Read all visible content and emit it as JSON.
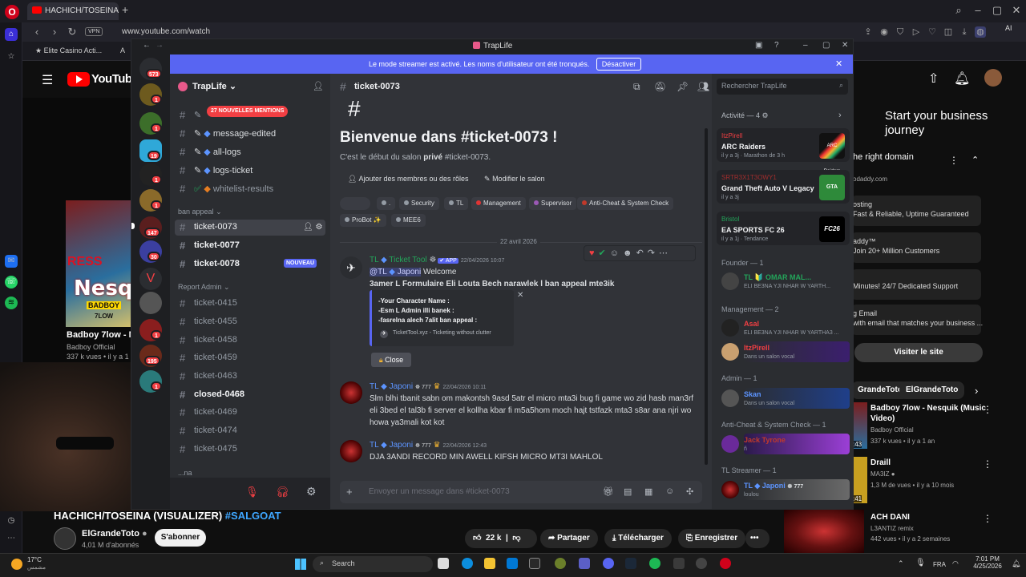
{
  "browser": {
    "tab_title": "HACHICH/TOSEINA (VISU...",
    "url": "www.youtube.com/watch",
    "vpn": "VPN",
    "ai_label": "AI",
    "bookmarks": [
      "Elite Casino Acti...",
      "A"
    ]
  },
  "youtube": {
    "logo_text": "YouTube",
    "video_title": "HACHICH/TOSEINA (VISUALIZER)",
    "video_hashtag": "#SALGOAT",
    "channel": "ElGrandeToto",
    "subs": "4,01 M d'abonnés",
    "subscribe": "S'abonner",
    "likes": "22 k",
    "share": "Partager",
    "download": "Télécharger",
    "save": "Enregistrer",
    "more": "•••",
    "side_thumb": {
      "ress": "RESS",
      "nesq": "Nesqui",
      "badboy": "BADBOY",
      "seven_low": "7LOW"
    },
    "side_video": {
      "title": "Badboy 7low - N",
      "channel": "Badboy Official",
      "stats": "337 k vues • il y a 1"
    },
    "ad": {
      "headline": "Start your business journey",
      "domain": "he right domain",
      "site": "odaddy.com",
      "lines": [
        "osting",
        "Fast & Reliable, Uptime Guaranteed",
        "addy™",
        "Join 20+ Million Customers",
        "Minutes! 24/7 Dedicated Support",
        "g Email",
        "with email that matches your business ..."
      ],
      "visit": "Visiter le site"
    },
    "chips": [
      "GrandeToto",
      "ElGrandeToto"
    ],
    "recs": [
      {
        "title": "Badboy 7low - Nesquik (Music",
        "title2": "Video)",
        "channel": "Badboy Official",
        "stats": "337 k vues • il y a 1 an",
        "dur": ":43"
      },
      {
        "title": "Draill",
        "channel": "MA3IZ",
        "stats": "1,3 M de vues • il y a 10 mois",
        "dur": ":41"
      },
      {
        "title": "ACH DANI",
        "channel": "L3ANTIZ remix",
        "stats": "442 vues • il y a 2 semaines",
        "dur": ""
      }
    ]
  },
  "taskbar": {
    "temp": "17°C",
    "weather": "مشمس",
    "search": "Search",
    "lang": "FRA",
    "time": "7:01 PM",
    "date": "4/25/2026"
  },
  "discord": {
    "app_title": "TrapLife",
    "banner": "Le mode streamer est activé. Les noms d'utilisateur ont été tronqués.",
    "banner_btn": "Désactiver",
    "guild": "TrapLife",
    "mentions_pill": "27 NOUVELLES MENTIONS",
    "server_badges": [
      "573",
      "1",
      "1",
      "19",
      "1",
      "1",
      "147",
      "30",
      "1",
      "195",
      "1"
    ],
    "channels_top": [
      "message-edited",
      "all-logs",
      "logs-ticket",
      "whitelist-results"
    ],
    "cat_ban": "ban appeal",
    "ban_channels": [
      "ticket-0073",
      "ticket-0077",
      "ticket-0078"
    ],
    "nouveau": "NOUVEAU",
    "cat_report": "Report Admin",
    "report_channels": [
      "ticket-0415",
      "ticket-0455",
      "ticket-0458",
      "ticket-0459",
      "ticket-0463",
      "closed-0468",
      "ticket-0469",
      "ticket-0474",
      "ticket-0475"
    ],
    "cat_partial": "...na",
    "chat": {
      "channel": "ticket-0073",
      "welcome_title": "Bienvenue dans #ticket-0073 !",
      "welcome_pre": "C'est le début du salon ",
      "welcome_bold": "privé",
      "welcome_post": " #ticket-0073.",
      "add_members": "Ajouter des membres ou des rôles",
      "edit_channel": "Modifier le salon",
      "roles": [
        {
          "name": ".",
          "color": "#949ba4"
        },
        {
          "name": "Security",
          "color": "#949ba4"
        },
        {
          "name": "TL",
          "color": "#949ba4"
        },
        {
          "name": "Management",
          "color": "#e03434"
        },
        {
          "name": "Supervisor",
          "color": "#9b59b6"
        },
        {
          "name": "Anti-Cheat & System Check",
          "color": "#c0392b"
        },
        {
          "name": "ProBot ✨",
          "color": "#949ba4"
        },
        {
          "name": "MEE6",
          "color": "#949ba4"
        }
      ],
      "date": "22 avril 2026",
      "msg1": {
        "tag": "TL",
        "name": "Ticket Tool",
        "app": "✔ APP",
        "time": "22/04/2026 10:07",
        "mention_tag": "@TL",
        "mention_name": "Japoni",
        "welcome_word": "Welcome",
        "line2": "3amer L Formulaire Eli Louta Bech narawlek l ban appeal mte3ik",
        "embed": [
          "-Your Character Name :",
          "-Esm L Admin illi banek :",
          "-fasrelna alech 7alit ban appeal :"
        ],
        "embed_footer": "TicketTool.xyz - Ticketing without clutter",
        "close": "Close"
      },
      "msg2": {
        "tag": "TL",
        "name": "Japoni",
        "badge": "777",
        "time": "22/04/2026 10:11",
        "text": "Slm blhi tbanit sabn om makontsh 9asd 5atr el micro mta3i bug fi game wo zid hasb man3rf eli 3bed el tal3b fi server el kollha kbar fi m5a5hom moch hajt tstfazk mta3 s8ar ana njri wo howa ya3mali kot kot"
      },
      "msg3": {
        "tag": "TL",
        "name": "Japoni",
        "badge": "777",
        "time": "22/04/2026 12:43",
        "text": "DJA 3ANDI RECORD MIN AWELL KIFSH MICRO MT3I MAHLOL"
      },
      "composer": "Envoyer un message dans #ticket-0073"
    },
    "members": {
      "search": "Rechercher TrapLife",
      "activity_head": "Activité — 4",
      "activities": [
        {
          "user": "ItzPirell",
          "game": "ARC Raiders",
          "meta": "il y a 3j  ·  Marathon de 3 h",
          "art": "ARC Raiders",
          "color": "#f23f43"
        },
        {
          "user": "SRTR3X1T3OWY1",
          "game": "Grand Theft Auto V Legacy",
          "meta": "il y a 3j",
          "art": "GTA",
          "color": "#a12d2d"
        },
        {
          "user": "Bristol",
          "game": "EA SPORTS FC 26",
          "meta": "il y a 1j  ·  Tendance",
          "art": "FC26",
          "color": "#23a55a"
        }
      ],
      "groups": [
        {
          "name": "Founder — 1"
        },
        {
          "name": "Management — 2"
        },
        {
          "name": "Admin — 1"
        },
        {
          "name": "Anti-Cheat & System Check — 1"
        },
        {
          "name": "TL Streamer — 1"
        }
      ],
      "founder": {
        "name": "TL 🔰 OMAR MAL...",
        "sub": "ELI BE3NA YJI NHAR W YARTH..."
      },
      "mgmt1": {
        "name": "Asal",
        "sub": "ELI BE3NA YJI NHAR W YARTHA3 ..."
      },
      "mgmt2": {
        "name": "ItzPirell",
        "sub": "Dans un salon vocal"
      },
      "admin": {
        "name": "Skan",
        "sub": "Dans un salon vocal"
      },
      "anticheat": {
        "name": "Jack Tyrone",
        "sub": "ñ"
      },
      "streamer": {
        "name": "TL ◆ Japoni",
        "badge": "777",
        "sub": "loulou"
      }
    }
  }
}
